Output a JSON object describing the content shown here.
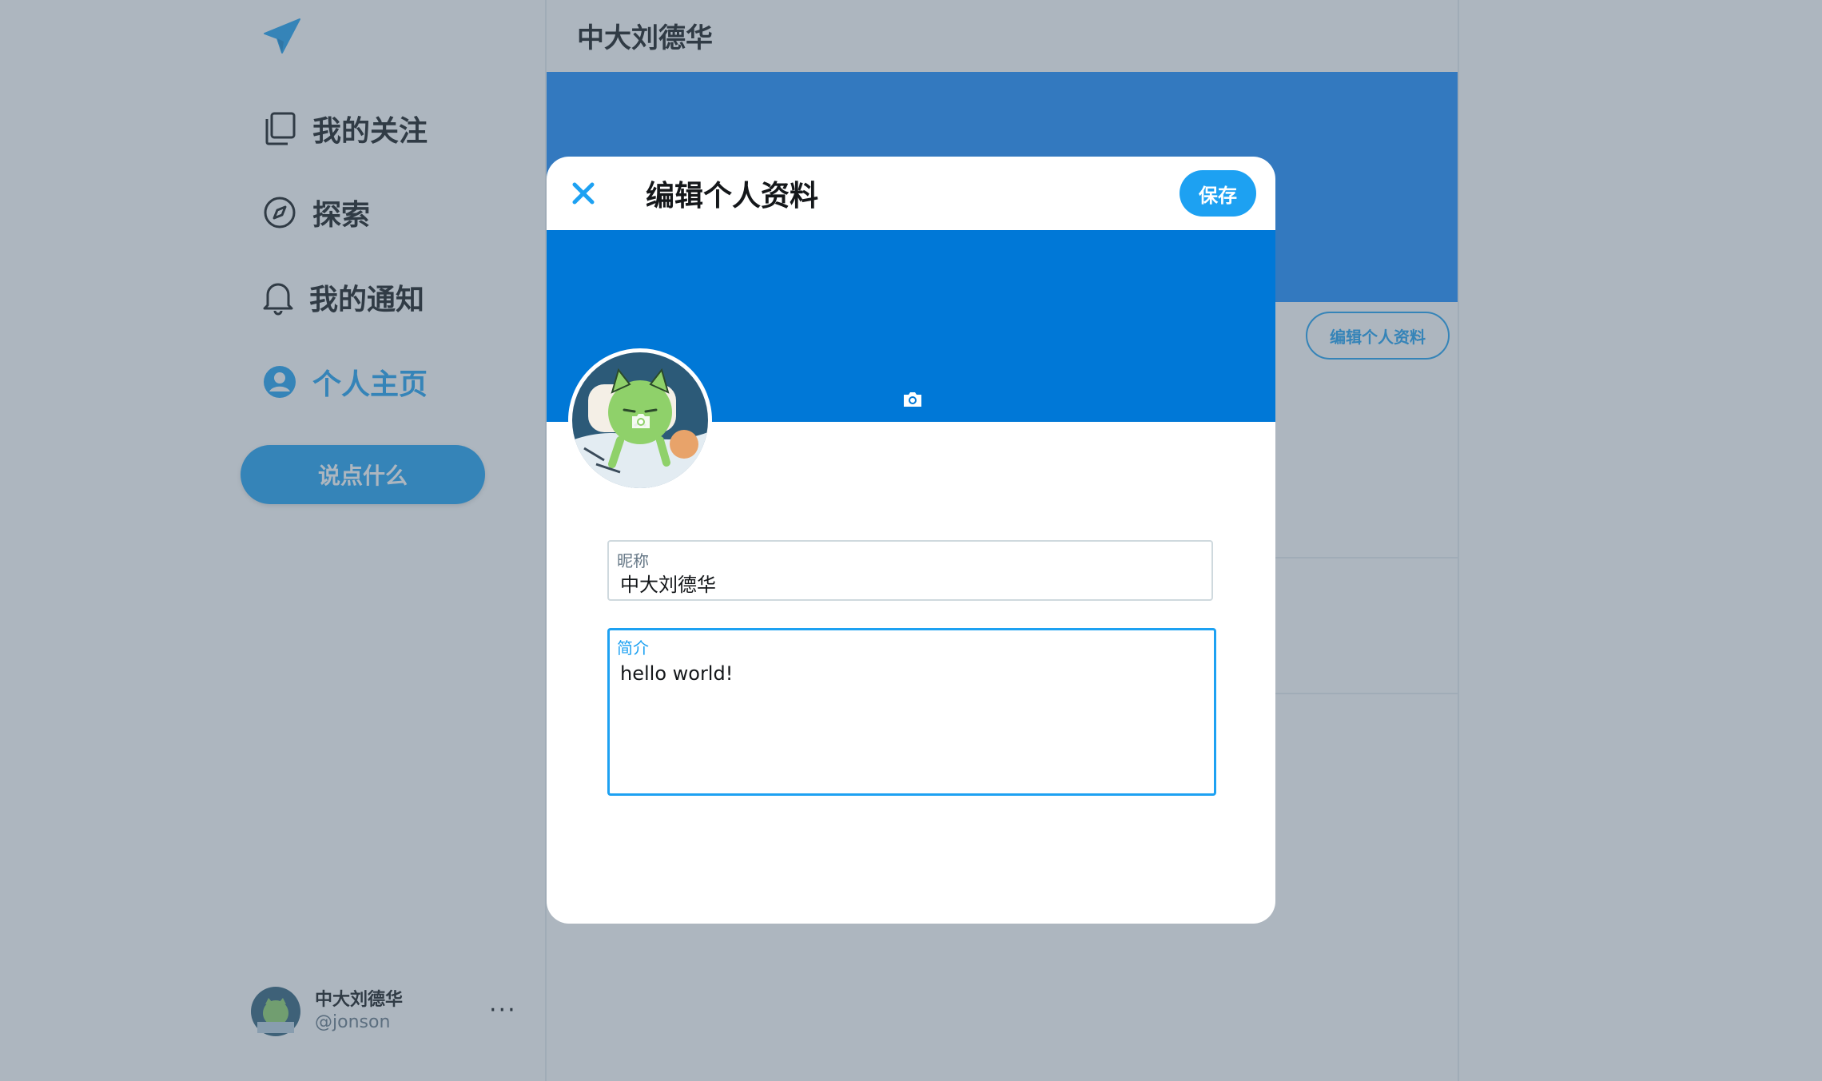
{
  "sidebar": {
    "logo_icon": "paper-plane-icon",
    "items": [
      {
        "label": "我的关注",
        "icon": "stack-icon"
      },
      {
        "label": "探索",
        "icon": "compass-icon"
      },
      {
        "label": "我的通知",
        "icon": "bell-icon"
      },
      {
        "label": "个人主页",
        "icon": "user-circle-icon",
        "active": true
      }
    ],
    "tweet_button": "说点什么",
    "account": {
      "name": "中大刘德华",
      "handle": "@jonson",
      "more": "···"
    }
  },
  "main": {
    "header_title": "中大刘德华",
    "edit_profile_button": "编辑个人资料"
  },
  "modal": {
    "title": "编辑个人资料",
    "save_button": "保存",
    "fields": {
      "nickname": {
        "label": "昵称",
        "value": "中大刘德华"
      },
      "bio": {
        "label": "简介",
        "value": "hello world!"
      }
    }
  },
  "colors": {
    "accent": "#1da1f2",
    "banner": "#0078d7",
    "overlay": "rgba(80,100,120,0.47)"
  }
}
